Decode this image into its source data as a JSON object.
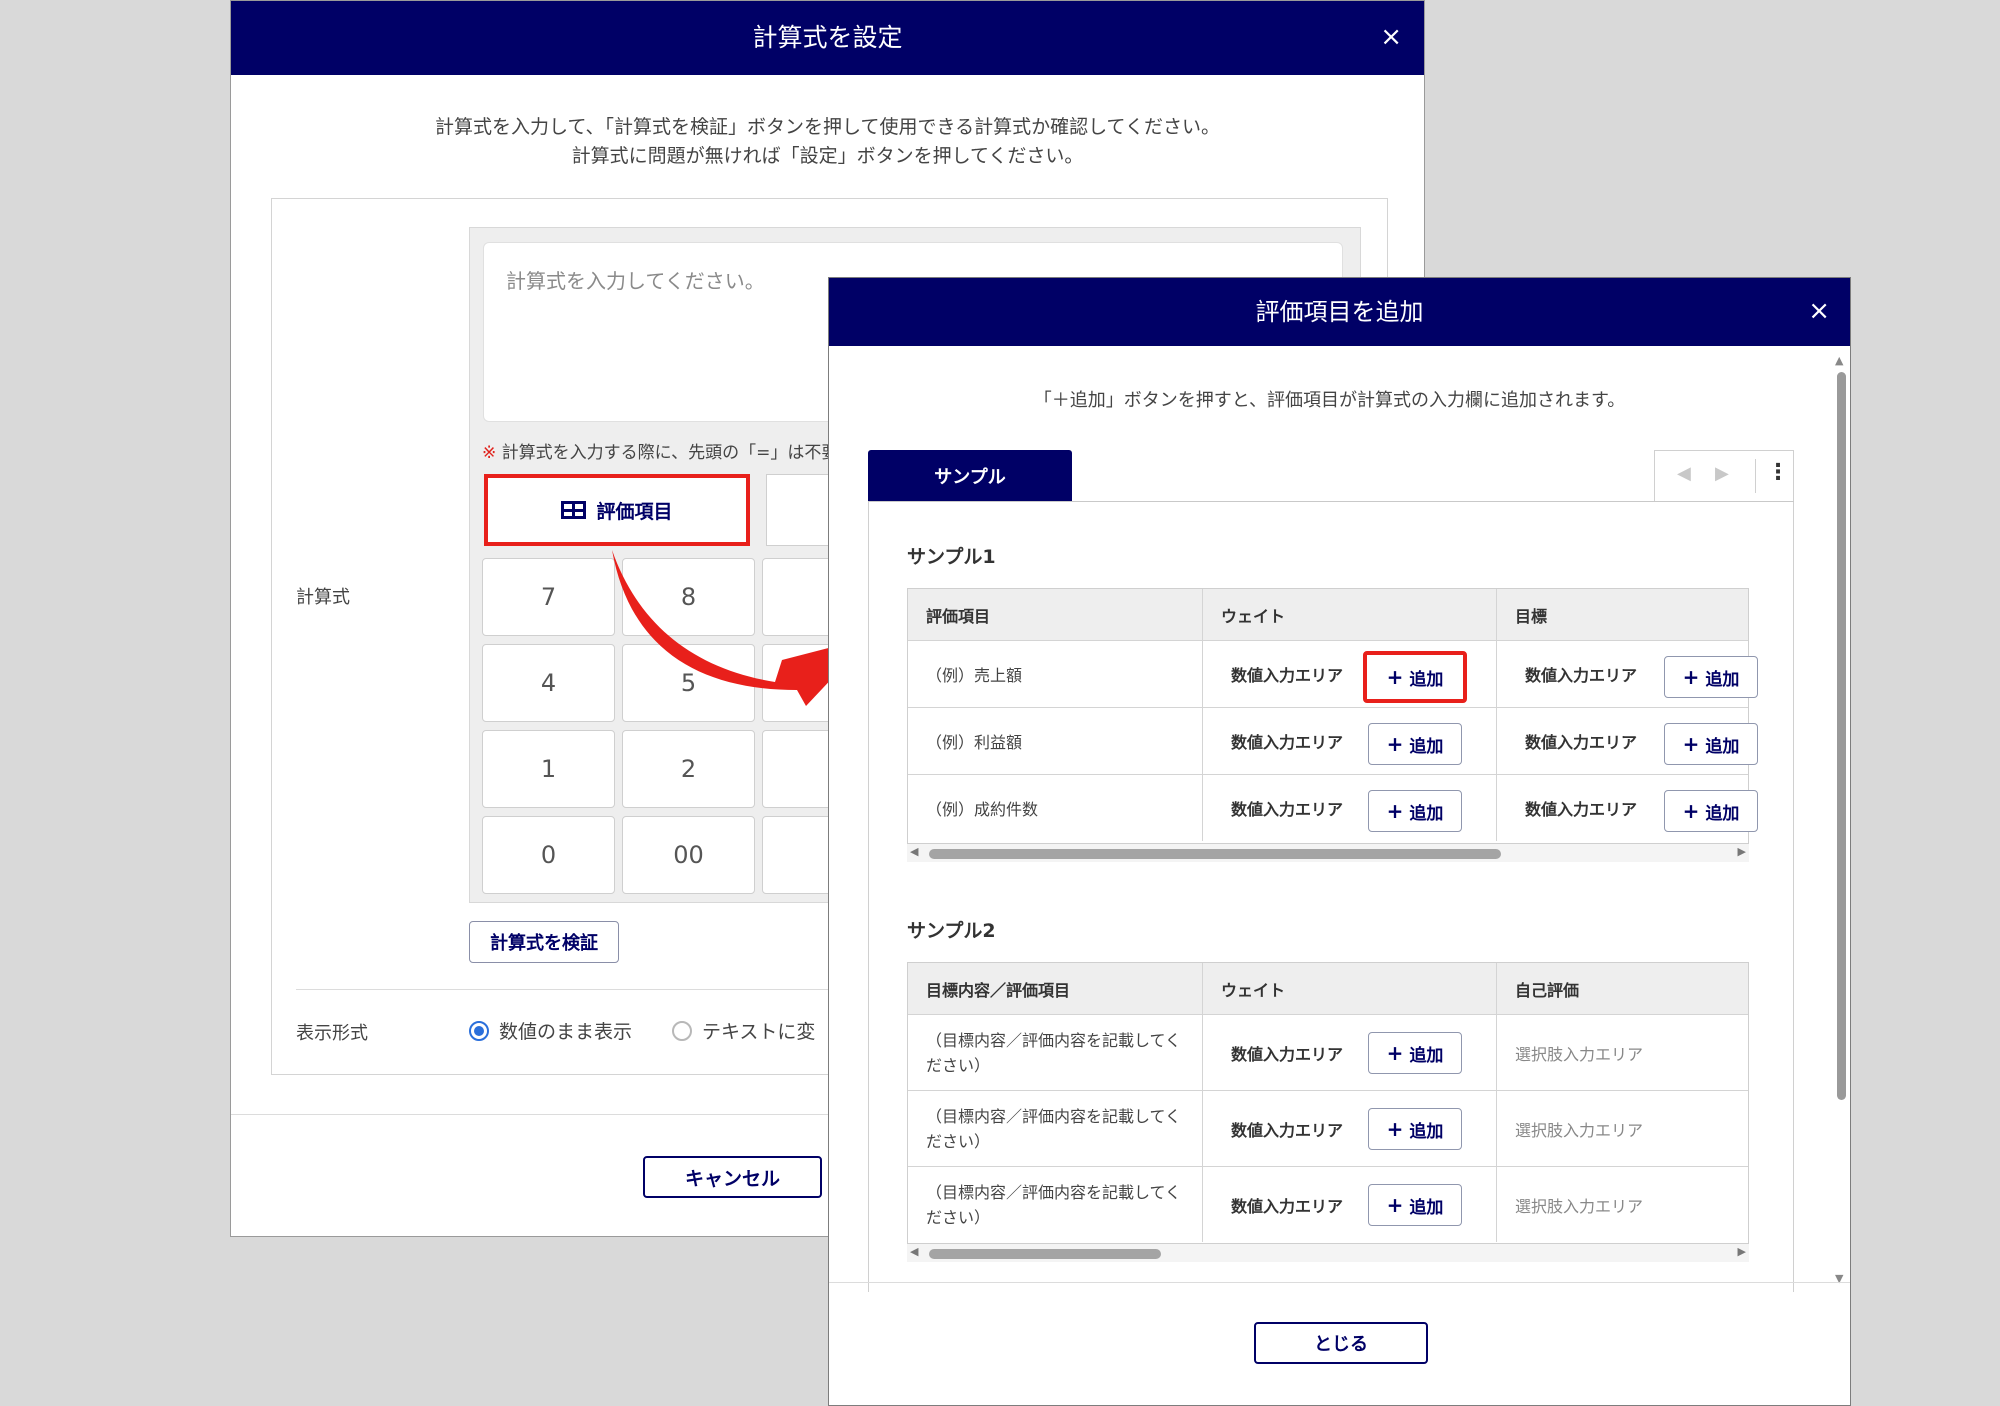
{
  "formula_dialog": {
    "title": "計算式を設定",
    "close": "×",
    "desc_line1": "計算式を入力して、「計算式を検証」ボタンを押して使用できる計算式か確認してください。",
    "desc_line2": "計算式に問題が無ければ「設定」ボタンを押してください。",
    "formula_label": "計算式",
    "formula_placeholder": "計算式を入力してください。",
    "note_mark": "※",
    "note_text": "計算式を入力する際に、先頭の「=」は不要",
    "eval_item_button": "評価項目",
    "keypad": [
      "7",
      "8",
      "4",
      "5",
      "1",
      "2",
      "0",
      "00"
    ],
    "verify_button": "計算式を検証",
    "display_label": "表示形式",
    "radio_numeric": "数値のまま表示",
    "radio_text": "テキストに変",
    "cancel_button": "キャンセル"
  },
  "add_dialog": {
    "title": "評価項目を追加",
    "close": "×",
    "desc": "「＋追加」ボタンを押すと、評価項目が計算式の入力欄に追加されます。",
    "tab": "サンプル",
    "tab_prev": "◀",
    "tab_next": "▶",
    "tab_more": "⋮",
    "add_plus": "+",
    "add_label": "追加",
    "close_button": "とじる",
    "sample1": {
      "title": "サンプル1",
      "headers": [
        "評価項目",
        "ウェイト",
        "目標"
      ],
      "rows": [
        {
          "item": "（例）売上額",
          "weight": "数値入力エリア",
          "target": "数値入力エリア"
        },
        {
          "item": "（例）利益額",
          "weight": "数値入力エリア",
          "target": "数値入力エリア"
        },
        {
          "item": "（例）成約件数",
          "weight": "数値入力エリア",
          "target": "数値入力エリア"
        }
      ]
    },
    "sample2": {
      "title": "サンプル2",
      "headers": [
        "目標内容／評価項目",
        "ウェイト",
        "自己評価"
      ],
      "rows": [
        {
          "item": "（目標内容／評価内容を記載してください）",
          "weight": "数値入力エリア",
          "self": "選択肢入力エリア"
        },
        {
          "item": "（目標内容／評価内容を記載してください）",
          "weight": "数値入力エリア",
          "self": "選択肢入力エリア"
        },
        {
          "item": "（目標内容／評価内容を記載してください）",
          "weight": "数値入力エリア",
          "self": "選択肢入力エリア"
        }
      ]
    }
  },
  "colors": {
    "header_navy": "#000066",
    "highlight_red": "#e8201b",
    "radio_blue": "#2a6fdb"
  },
  "icons": {
    "eval_item": "table-icon",
    "close": "close-icon",
    "pointer": "curved-arrow-icon"
  }
}
